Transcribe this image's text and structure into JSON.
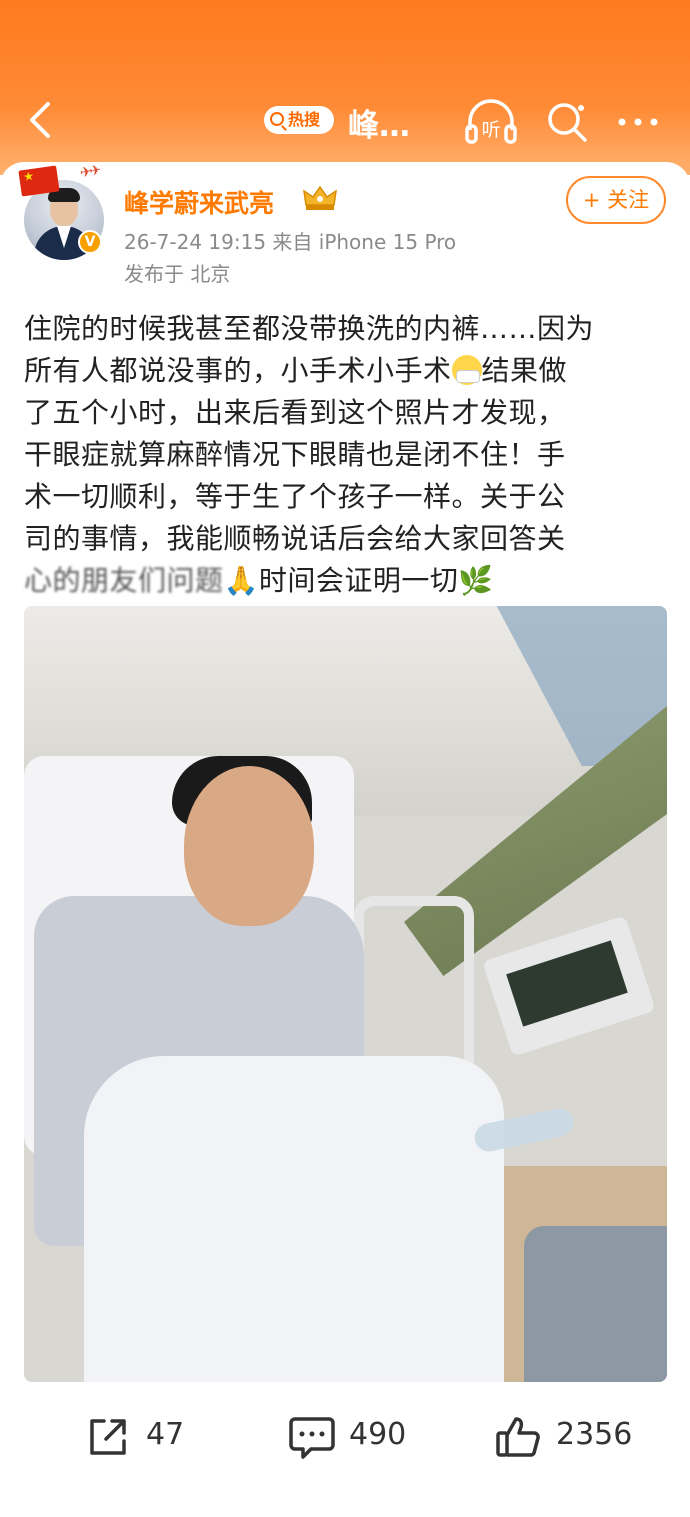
{
  "header": {
    "hot_badge": "热搜",
    "title": "峰…",
    "listen_label": "听"
  },
  "post": {
    "username": "峰学蔚来武亮",
    "meta": "26-7-24 19:15  来自 iPhone 15 Pro",
    "location": "发布于 北京",
    "follow_label": "+ 关注",
    "text_lines": [
      "住院的时候我甚至都没带换洗的内裤……因为",
      "所有人都说没事的，小手术小手术",
      "结果做",
      "了五个小时，出来后看到这个照片才发现，",
      "干眼症就算麻醉情况下眼睛也是闭不住！手",
      "术一切顺利，等于生了个孩子一样。关于公",
      "司的事情，我能顺畅说话后会给大家回答关",
      "心的朋友们问题",
      "时间会证明一切"
    ]
  },
  "actions": {
    "repost_count": "47",
    "comment_count": "490",
    "like_count": "2356"
  },
  "icons": {
    "back": "back-arrow-icon",
    "listen": "headphones-icon",
    "search": "search-icon",
    "more": "more-dots-icon",
    "repost": "share-icon",
    "comment": "comment-icon",
    "like": "thumbs-up-icon"
  },
  "colors": {
    "brand_orange": "#ff7a00",
    "header_gradient_top": "#ff7a1f"
  }
}
